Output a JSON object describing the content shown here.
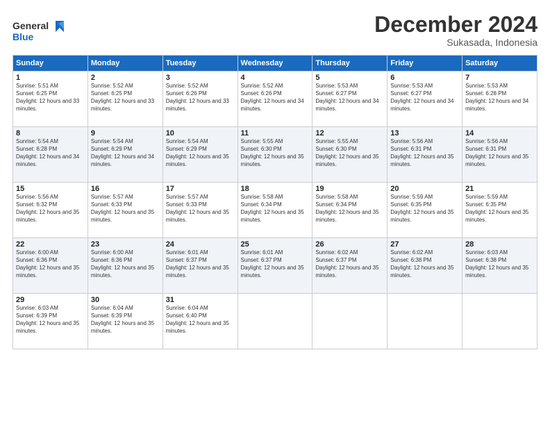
{
  "logo": {
    "text_general": "General",
    "text_blue": "Blue"
  },
  "title": "December 2024",
  "subtitle": "Sukasada, Indonesia",
  "days_header": [
    "Sunday",
    "Monday",
    "Tuesday",
    "Wednesday",
    "Thursday",
    "Friday",
    "Saturday"
  ],
  "weeks": [
    [
      {
        "day": "1",
        "sunrise": "5:51 AM",
        "sunset": "6:25 PM",
        "daylight": "12 hours and 33 minutes."
      },
      {
        "day": "2",
        "sunrise": "5:52 AM",
        "sunset": "6:25 PM",
        "daylight": "12 hours and 33 minutes."
      },
      {
        "day": "3",
        "sunrise": "5:52 AM",
        "sunset": "6:26 PM",
        "daylight": "12 hours and 33 minutes."
      },
      {
        "day": "4",
        "sunrise": "5:52 AM",
        "sunset": "6:26 PM",
        "daylight": "12 hours and 34 minutes."
      },
      {
        "day": "5",
        "sunrise": "5:53 AM",
        "sunset": "6:27 PM",
        "daylight": "12 hours and 34 minutes."
      },
      {
        "day": "6",
        "sunrise": "5:53 AM",
        "sunset": "6:27 PM",
        "daylight": "12 hours and 34 minutes."
      },
      {
        "day": "7",
        "sunrise": "5:53 AM",
        "sunset": "6:28 PM",
        "daylight": "12 hours and 34 minutes."
      }
    ],
    [
      {
        "day": "8",
        "sunrise": "5:54 AM",
        "sunset": "6:28 PM",
        "daylight": "12 hours and 34 minutes."
      },
      {
        "day": "9",
        "sunrise": "5:54 AM",
        "sunset": "6:29 PM",
        "daylight": "12 hours and 34 minutes."
      },
      {
        "day": "10",
        "sunrise": "5:54 AM",
        "sunset": "6:29 PM",
        "daylight": "12 hours and 35 minutes."
      },
      {
        "day": "11",
        "sunrise": "5:55 AM",
        "sunset": "6:30 PM",
        "daylight": "12 hours and 35 minutes."
      },
      {
        "day": "12",
        "sunrise": "5:55 AM",
        "sunset": "6:30 PM",
        "daylight": "12 hours and 35 minutes."
      },
      {
        "day": "13",
        "sunrise": "5:56 AM",
        "sunset": "6:31 PM",
        "daylight": "12 hours and 35 minutes."
      },
      {
        "day": "14",
        "sunrise": "5:56 AM",
        "sunset": "6:31 PM",
        "daylight": "12 hours and 35 minutes."
      }
    ],
    [
      {
        "day": "15",
        "sunrise": "5:56 AM",
        "sunset": "6:32 PM",
        "daylight": "12 hours and 35 minutes."
      },
      {
        "day": "16",
        "sunrise": "5:57 AM",
        "sunset": "6:33 PM",
        "daylight": "12 hours and 35 minutes."
      },
      {
        "day": "17",
        "sunrise": "5:57 AM",
        "sunset": "6:33 PM",
        "daylight": "12 hours and 35 minutes."
      },
      {
        "day": "18",
        "sunrise": "5:58 AM",
        "sunset": "6:34 PM",
        "daylight": "12 hours and 35 minutes."
      },
      {
        "day": "19",
        "sunrise": "5:58 AM",
        "sunset": "6:34 PM",
        "daylight": "12 hours and 35 minutes."
      },
      {
        "day": "20",
        "sunrise": "5:59 AM",
        "sunset": "6:35 PM",
        "daylight": "12 hours and 35 minutes."
      },
      {
        "day": "21",
        "sunrise": "5:59 AM",
        "sunset": "6:35 PM",
        "daylight": "12 hours and 35 minutes."
      }
    ],
    [
      {
        "day": "22",
        "sunrise": "6:00 AM",
        "sunset": "6:36 PM",
        "daylight": "12 hours and 35 minutes."
      },
      {
        "day": "23",
        "sunrise": "6:00 AM",
        "sunset": "6:36 PM",
        "daylight": "12 hours and 35 minutes."
      },
      {
        "day": "24",
        "sunrise": "6:01 AM",
        "sunset": "6:37 PM",
        "daylight": "12 hours and 35 minutes."
      },
      {
        "day": "25",
        "sunrise": "6:01 AM",
        "sunset": "6:37 PM",
        "daylight": "12 hours and 35 minutes."
      },
      {
        "day": "26",
        "sunrise": "6:02 AM",
        "sunset": "6:37 PM",
        "daylight": "12 hours and 35 minutes."
      },
      {
        "day": "27",
        "sunrise": "6:02 AM",
        "sunset": "6:38 PM",
        "daylight": "12 hours and 35 minutes."
      },
      {
        "day": "28",
        "sunrise": "6:03 AM",
        "sunset": "6:38 PM",
        "daylight": "12 hours and 35 minutes."
      }
    ],
    [
      {
        "day": "29",
        "sunrise": "6:03 AM",
        "sunset": "6:39 PM",
        "daylight": "12 hours and 35 minutes."
      },
      {
        "day": "30",
        "sunrise": "6:04 AM",
        "sunset": "6:39 PM",
        "daylight": "12 hours and 35 minutes."
      },
      {
        "day": "31",
        "sunrise": "6:04 AM",
        "sunset": "6:40 PM",
        "daylight": "12 hours and 35 minutes."
      },
      null,
      null,
      null,
      null
    ]
  ]
}
